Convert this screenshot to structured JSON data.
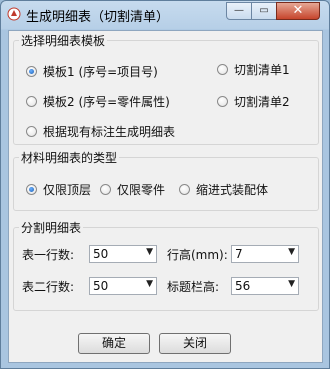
{
  "window": {
    "title": "生成明细表（切割清单）",
    "icon": "app-logo-icon"
  },
  "template_group": {
    "title": "选择明细表模板",
    "options": [
      {
        "label": "模板1 (序号=项目号)",
        "selected": true
      },
      {
        "label": "切割清单1",
        "selected": false
      },
      {
        "label": "模板2 (序号=零件属性)",
        "selected": false
      },
      {
        "label": "切割清单2",
        "selected": false
      },
      {
        "label": "根据现有标注生成明细表",
        "selected": false
      }
    ]
  },
  "type_group": {
    "title": "材料明细表的类型",
    "options": [
      {
        "label": "仅限顶层",
        "selected": true
      },
      {
        "label": "仅限零件",
        "selected": false
      },
      {
        "label": "缩进式装配体",
        "selected": false
      }
    ]
  },
  "split_group": {
    "title": "分割明细表",
    "table1_rows_label": "表一行数:",
    "table1_rows_value": "50",
    "row_height_label": "行高(mm):",
    "row_height_value": "7",
    "table2_rows_label": "表二行数:",
    "table2_rows_value": "50",
    "title_bar_height_label": "标题栏高:",
    "title_bar_height_value": "56"
  },
  "buttons": {
    "ok": "确定",
    "close": "关闭"
  }
}
